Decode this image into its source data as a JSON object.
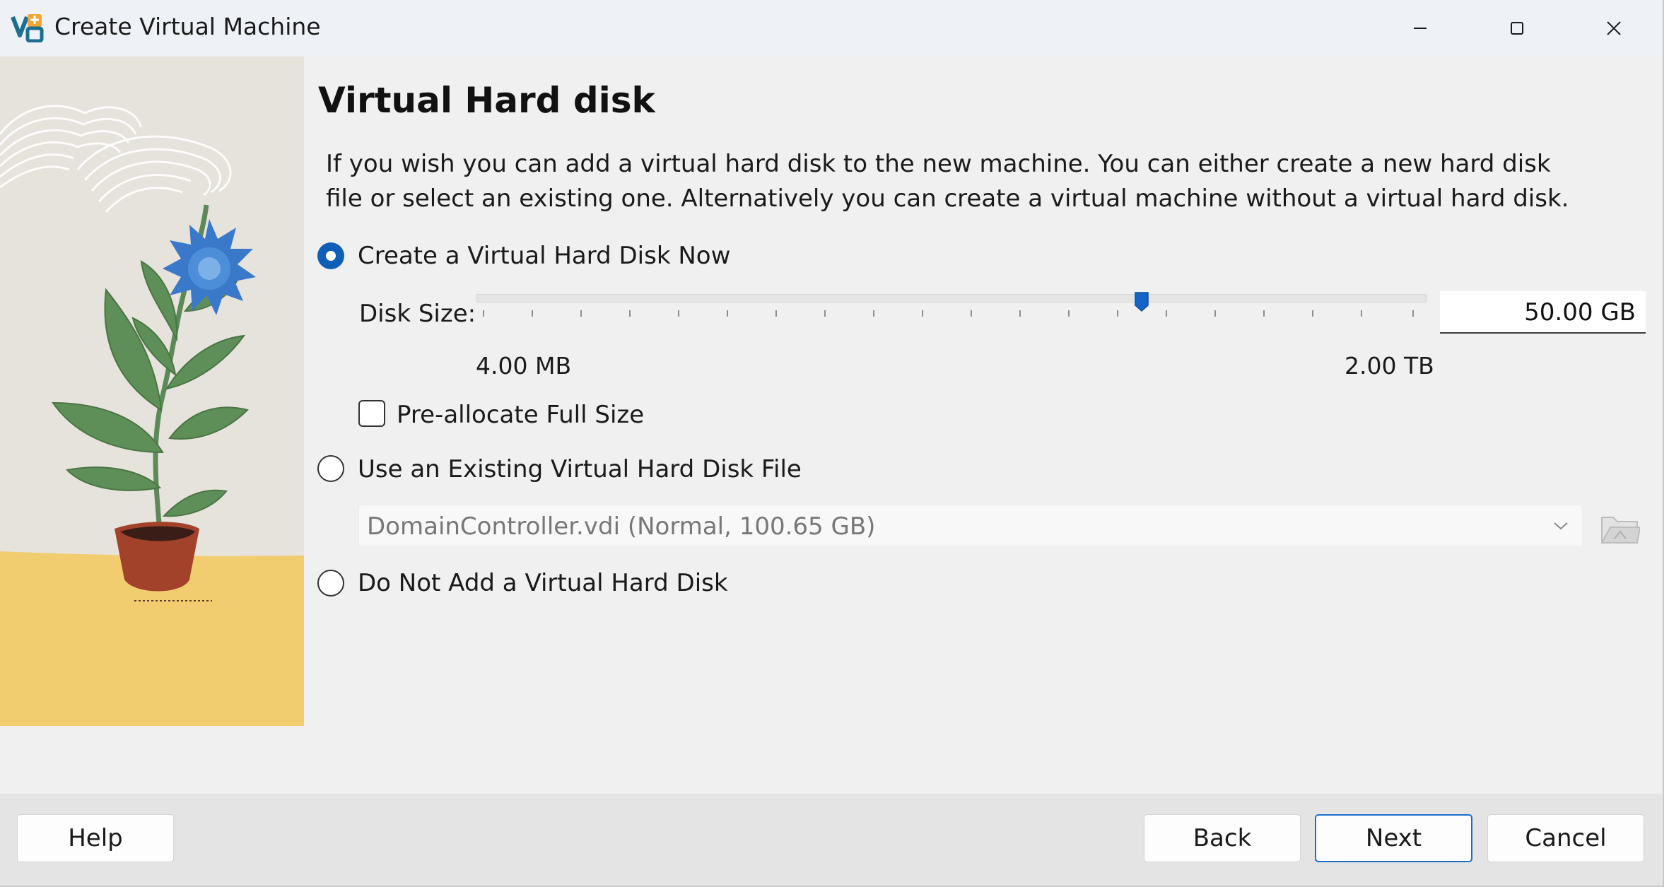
{
  "window": {
    "title": "Create Virtual Machine"
  },
  "page": {
    "heading": "Virtual Hard disk",
    "description": "If you wish you can add a virtual hard disk to the new machine. You can either create a new hard disk file or select an existing one. Alternatively you can create a virtual machine without a virtual hard disk."
  },
  "options": {
    "create_new": {
      "label": "Create a Virtual Hard Disk Now",
      "selected": true
    },
    "use_existing": {
      "label": "Use an Existing Virtual Hard Disk File",
      "selected": false
    },
    "none": {
      "label": "Do Not Add a Virtual Hard Disk",
      "selected": false
    }
  },
  "disk_size": {
    "label": "Disk Size:",
    "value": "50.00 GB",
    "min_label": "4.00 MB",
    "max_label": "2.00 TB",
    "slider_position": 0.7
  },
  "preallocate": {
    "label": "Pre-allocate Full Size",
    "checked": false
  },
  "existing_disk": {
    "selected": "DomainController.vdi (Normal, 100.65 GB)"
  },
  "buttons": {
    "help": "Help",
    "back": "Back",
    "next": "Next",
    "cancel": "Cancel"
  },
  "colors": {
    "accent": "#0f5fb6",
    "primary_border": "#1a6fc4",
    "art_floor": "#f2cd70",
    "art_wall": "#e6e2dc"
  },
  "icons": {
    "app": "virtualbox-icon",
    "minimize": "minimize-icon",
    "maximize": "maximize-icon",
    "close": "close-icon",
    "dropdown": "chevron-down-icon",
    "folder": "folder-icon"
  }
}
